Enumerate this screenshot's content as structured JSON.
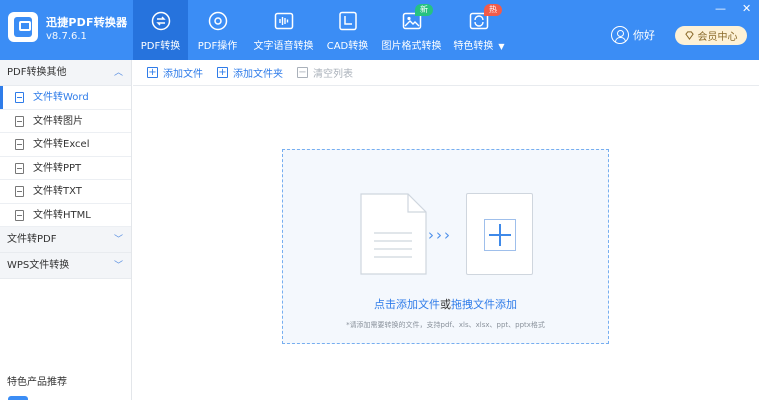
{
  "app": {
    "title": "迅捷PDF转换器",
    "version": "v8.7.6.1"
  },
  "nav": [
    {
      "label": "PDF转换",
      "icon": "convert-icon",
      "active": true
    },
    {
      "label": "PDF操作",
      "icon": "gear-icon"
    },
    {
      "label": "文字语音转换",
      "icon": "voice-wave-icon"
    },
    {
      "label": "CAD转换",
      "icon": "cad-icon"
    },
    {
      "label": "图片格式转换",
      "icon": "image-icon",
      "badge": "新"
    },
    {
      "label": "特色转换",
      "icon": "special-convert-icon",
      "badge": "热"
    }
  ],
  "user": {
    "greeting": "你好",
    "vip_label": "会员中心"
  },
  "window_controls": {
    "minimize": "—",
    "close": "✕"
  },
  "sidebar": {
    "sections": [
      {
        "label": "PDF转换其他",
        "expanded": true,
        "items": [
          {
            "label": "文件转Word",
            "active": true
          },
          {
            "label": "文件转图片"
          },
          {
            "label": "文件转Excel"
          },
          {
            "label": "文件转PPT"
          },
          {
            "label": "文件转TXT"
          },
          {
            "label": "文件转HTML"
          }
        ]
      },
      {
        "label": "文件转PDF",
        "expanded": false
      },
      {
        "label": "WPS文件转换",
        "expanded": false
      }
    ],
    "recommend_label": "特色产品推荐"
  },
  "toolbar": {
    "add_file": "添加文件",
    "add_folder": "添加文件夹",
    "clear_list": "清空列表"
  },
  "dropzone": {
    "click_add": "点击添加文件",
    "or": "或",
    "drag_add": "拖拽文件添加",
    "hint": "*请添加需要转换的文件，支持pdf、xls、xlsx、ppt、pptx格式"
  },
  "colors": {
    "primary": "#3b8df5",
    "active_nav": "#2673dd",
    "link": "#2f7ce9",
    "badge_new": "#26c281",
    "badge_hot": "#f25b4a"
  }
}
